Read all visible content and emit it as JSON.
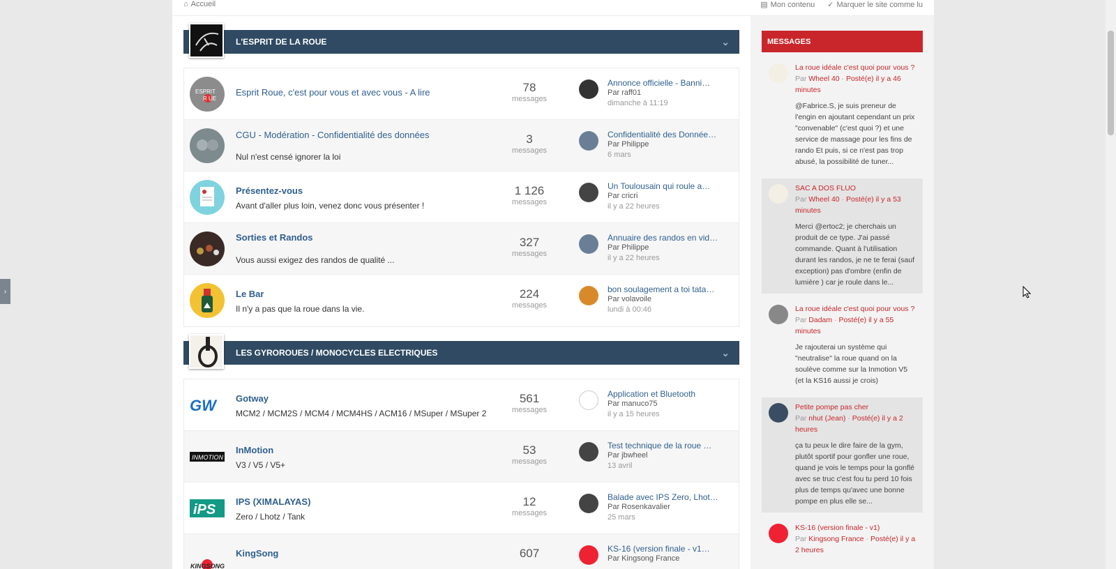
{
  "topbar": {
    "breadcrumb": "Accueil",
    "my_content": "Mon contenu",
    "mark_read": "Marquer le site comme lu"
  },
  "categories": [
    {
      "title": "L'ESPRIT DE LA ROUE",
      "forums": [
        {
          "title": "Esprit Roue, c'est pour vous et avec vous - A lire",
          "desc": "",
          "bold": false,
          "count": "78",
          "count_label": "messages",
          "last_title": "Annonce officielle - Banni…",
          "last_by": "Par raff01",
          "last_date": "dimanche à 11:19"
        },
        {
          "title": "CGU - Modération - Confidentialité des données",
          "desc": "Nul n'est censé ignorer la loi",
          "bold": false,
          "count": "3",
          "count_label": "messages",
          "last_title": "Confidentialité des Donnée…",
          "last_by": "Par Philippe",
          "last_date": "6 mars"
        },
        {
          "title": "Présentez-vous",
          "desc": "Avant d'aller plus loin, venez donc vous présenter !",
          "bold": true,
          "count": "1 126",
          "count_label": "messages",
          "last_title": "Un Toulousain qui roule a…",
          "last_by": "Par cricri",
          "last_date": "il y a 22 heures"
        },
        {
          "title": "Sorties et Randos",
          "desc": "Vous aussi exigez des randos de qualité ...",
          "bold": true,
          "count": "327",
          "count_label": "messages",
          "last_title": "Annuaire des randos en vid…",
          "last_by": "Par Philippe",
          "last_date": "il y a 22 heures"
        },
        {
          "title": "Le Bar",
          "desc": "Il n'y a pas que la roue dans la vie.",
          "bold": true,
          "count": "224",
          "count_label": "messages",
          "last_title": "bon soulagement a toi tata…",
          "last_by": "Par volavoile",
          "last_date": "lundi à 00:46"
        }
      ]
    },
    {
      "title": "LES GYROROUES / MONOCYCLES ELECTRIQUES",
      "forums": [
        {
          "title": "Gotway",
          "desc": "MCM2 / MCM2S / MCM4 / MCM4HS / ACM16 / MSuper / MSuper 2",
          "bold": true,
          "count": "561",
          "count_label": "messages",
          "last_title": "Application et Bluetooth",
          "last_by": "Par manuco75",
          "last_date": "il y a 15 heures"
        },
        {
          "title": "InMotion",
          "desc": "V3 / V5 / V5+",
          "bold": true,
          "count": "53",
          "count_label": "messages",
          "last_title": "Test technique de la roue …",
          "last_by": "Par jbwheel",
          "last_date": "13 avril"
        },
        {
          "title": "IPS (XIMALAYAS)",
          "desc": "Zero / Lhotz / Tank",
          "bold": true,
          "count": "12",
          "count_label": "messages",
          "last_title": "Balade avec IPS Zero, Lhot…",
          "last_by": "Par Rosenkavalier",
          "last_date": "25 mars"
        },
        {
          "title": "KingSong",
          "desc": "",
          "bold": true,
          "count": "607",
          "count_label": "",
          "last_title": "KS-16 (version finale - v1…",
          "last_by": "Par Kingsong France",
          "last_date": ""
        }
      ]
    }
  ],
  "sidebar": {
    "title": "MESSAGES",
    "messages": [
      {
        "title": "La roue idéale c'est quoi pour vous ?",
        "author": "Wheel 40",
        "posted": "Posté(e) il y a 46 minutes",
        "body": "@Fabrice.S, je suis preneur de l'engin en ajoutant cependant un prix \"convenable\" (c'est quoi ?) et une service de massage pour les fins de rando  Et puis, si ce n'est pas trop abusé, la possibilité de tuner..."
      },
      {
        "title": "SAC A DOS FLUO",
        "author": "Wheel 40",
        "posted": "Posté(e) il y a 53 minutes",
        "body": "Merci @ertoc2; je cherchais un produit de ce type. J'ai passé commande. Quant à l'utilisation durant les randos, je ne te ferai (sauf exception) pas d'ombre (enfin de lumière ) car je roule dans le..."
      },
      {
        "title": "La roue idéale c'est quoi pour vous ?",
        "author": "Dadam",
        "posted": "Posté(e) il y a 55 minutes",
        "body": "Je rajouterai un système qui \"neutralise\" la roue quand on la soulève comme sur la Inmotion V5 (et la KS16 aussi je crois)"
      },
      {
        "title": "Petite pompe pas cher",
        "author": "nhut (Jean)",
        "posted": "Posté(e) il y a 2 heures",
        "body": "ça tu peux le dire faire de la gym, plutôt sportif pour gonfler une roue, quand je vois le temps pour la gonflé avec se truc c'est fou tu perd 10 fois plus de temps qu'avec une bonne pompe en plus elle se..."
      },
      {
        "title": "KS-16 (version finale - v1)",
        "author": "Kingsong France",
        "posted": "Posté(e) il y a 2 heures",
        "body": ""
      }
    ],
    "by_prefix": "Par",
    "separator": "·"
  }
}
